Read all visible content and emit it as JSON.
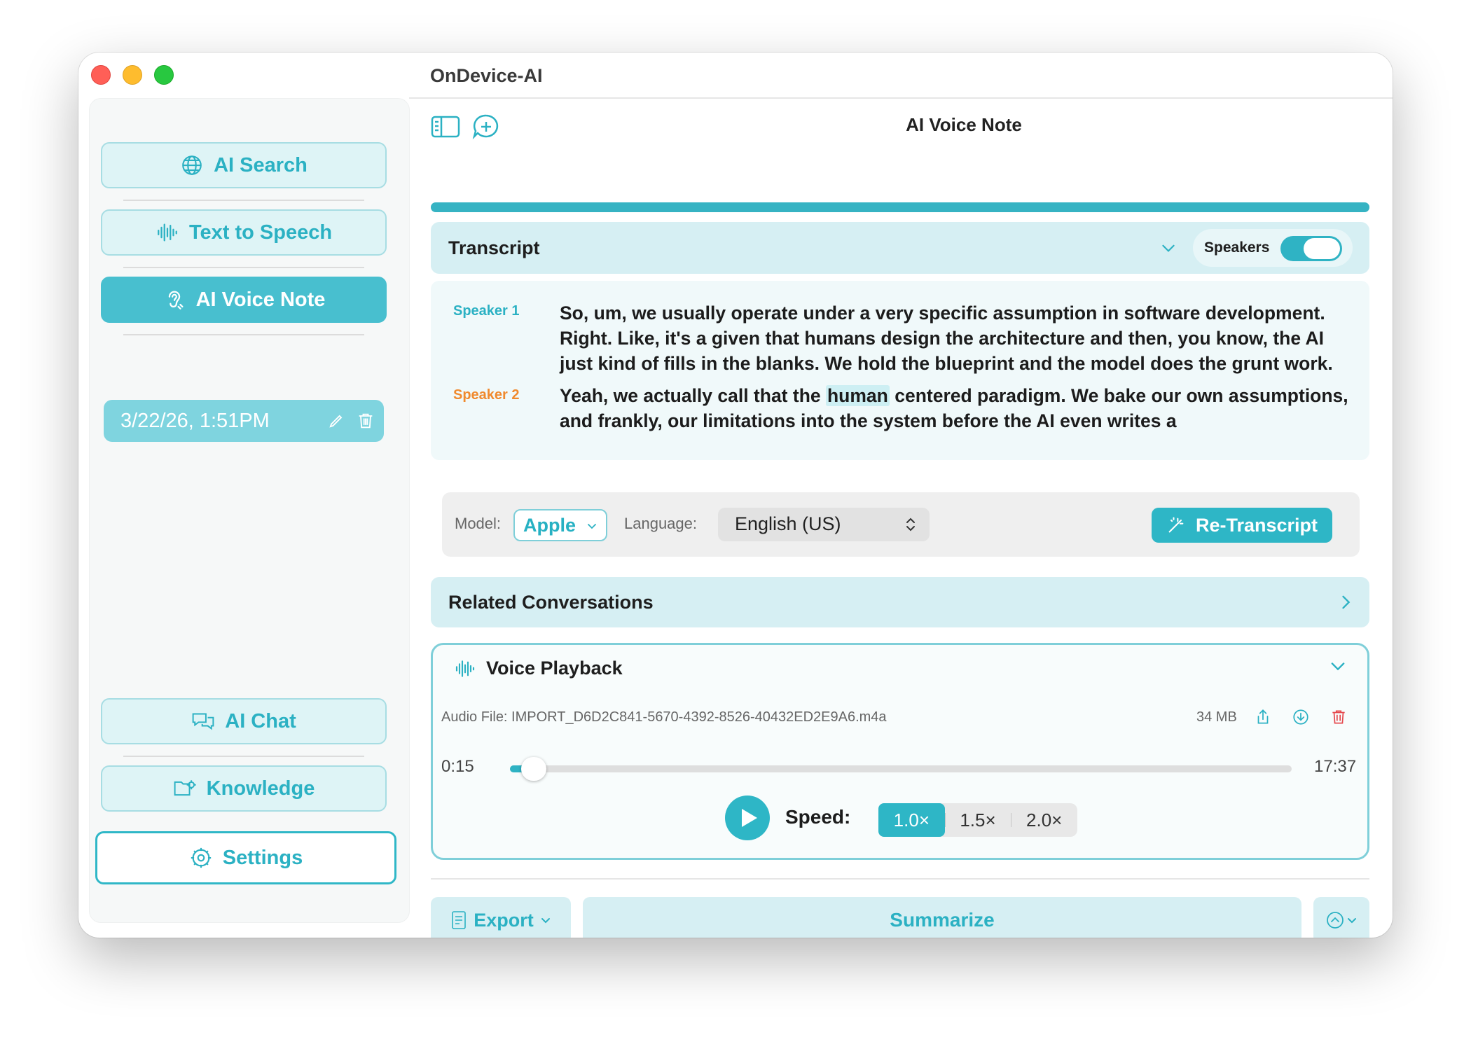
{
  "window": {
    "title": "OnDevice-AI"
  },
  "sidebar": {
    "top_items": [
      {
        "label": "AI Search",
        "icon": "globe-icon"
      },
      {
        "label": "Text to Speech",
        "icon": "waveform-icon"
      },
      {
        "label": "AI Voice Note",
        "icon": "ear-icon",
        "active": true
      }
    ],
    "notes": [
      {
        "label": "3/22/26, 1:51PM"
      }
    ],
    "bottom_items": [
      {
        "label": "AI Chat",
        "icon": "chat-bubbles-icon"
      },
      {
        "label": "Knowledge",
        "icon": "folder-gear-icon"
      },
      {
        "label": "Settings",
        "icon": "gear-icon"
      }
    ]
  },
  "toolbar": {
    "title": "AI Voice Note"
  },
  "progress": {
    "value": 1.0
  },
  "transcript": {
    "title": "Transcript",
    "speakers_label": "Speakers",
    "speakers_on": true,
    "segments": [
      {
        "speaker": "Speaker 1",
        "color": "#2bb1c3",
        "text": "So, um, we usually operate under a very specific assumption in software development. Right. Like, it's a given that humans design the architecture and then, you know, the AI just kind of fills in the blanks. We hold the blueprint and the model does the grunt work."
      },
      {
        "speaker": "Speaker 2",
        "color": "#f08a2e",
        "text_before": "Yeah, we actually call that the ",
        "highlight": "human",
        "text_after": " centered paradigm. We bake our own assumptions, and frankly, our limitations into the system before the AI even writes a"
      }
    ]
  },
  "controls": {
    "model_label": "Model:",
    "model_value": "Apple",
    "language_label": "Language:",
    "language_value": "English (US)",
    "retranscript_label": "Re-Transcript"
  },
  "related": {
    "title": "Related Conversations"
  },
  "playback": {
    "title": "Voice Playback",
    "file_label": "Audio File: IMPORT_D6D2C841-5670-4392-8526-40432ED2E9A6.m4a",
    "size": "34 MB",
    "current_time": "0:15",
    "total_time": "17:37",
    "position_fraction": 0.014,
    "speed_label": "Speed:",
    "speeds": [
      "1.0×",
      "1.5×",
      "2.0×"
    ],
    "selected_speed": 0
  },
  "actions": {
    "export_label": "Export",
    "summarize_label": "Summarize"
  },
  "colors": {
    "accent": "#2eb6c6",
    "accent_light": "#d6eff3",
    "speaker1": "#2bb1c3",
    "speaker2": "#f08a2e",
    "delete": "#e5484d"
  }
}
